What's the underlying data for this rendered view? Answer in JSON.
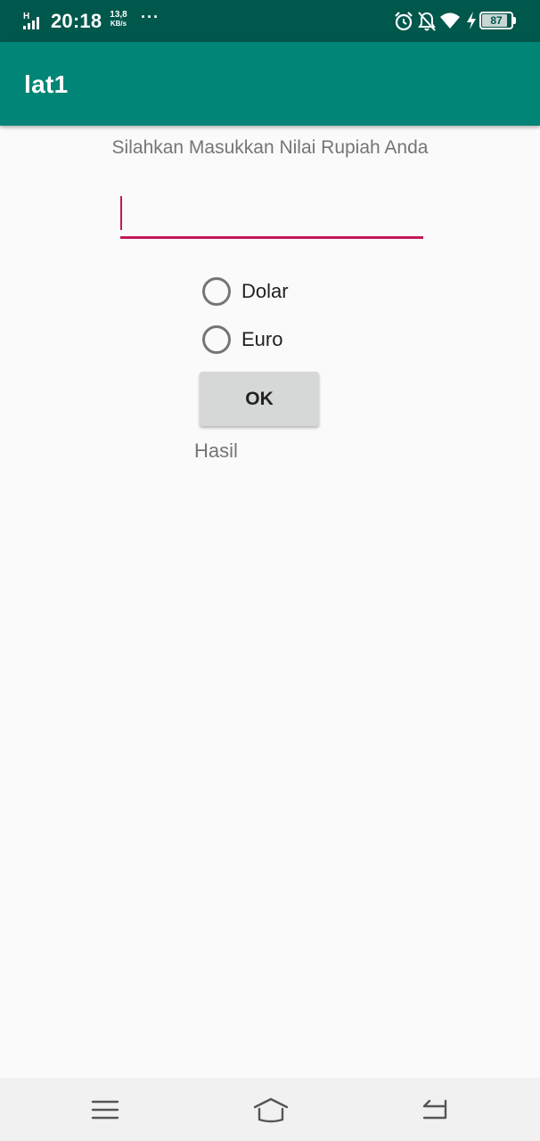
{
  "status_bar": {
    "network_type": "H",
    "time": "20:18",
    "speed_value": "13,8",
    "speed_unit": "KB/s",
    "more": "···",
    "battery_level": 87,
    "battery_text": "87",
    "icons": [
      "signal-icon",
      "alarm-icon",
      "notifications-off-icon",
      "wifi-icon",
      "charging-icon",
      "battery-icon"
    ]
  },
  "app_bar": {
    "title": "lat1"
  },
  "form": {
    "prompt": "Silahkan Masukkan Nilai Rupiah Anda",
    "input_value": "",
    "options": [
      {
        "label": "Dolar",
        "selected": false
      },
      {
        "label": "Euro",
        "selected": false
      }
    ],
    "ok_label": "OK",
    "result_label": "Hasil"
  },
  "nav_bar": {
    "icons": [
      "menu-icon",
      "home-icon",
      "back-icon"
    ]
  },
  "colors": {
    "status_bar": "#00574b",
    "app_bar": "#008577",
    "accent": "#c2185b",
    "background": "#fafafa"
  }
}
